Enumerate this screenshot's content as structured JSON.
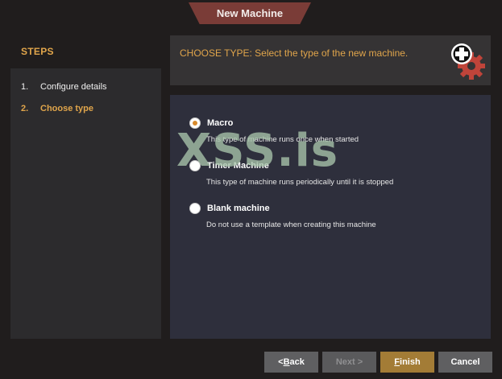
{
  "window": {
    "title": "New Machine"
  },
  "steps": {
    "header": "STEPS",
    "items": [
      {
        "num": "1.",
        "label": "Configure details",
        "active": false
      },
      {
        "num": "2.",
        "label": "Choose type",
        "active": true
      }
    ]
  },
  "banner": {
    "text": "CHOOSE TYPE: Select the type of the new machine.",
    "icon": "add-machine-gear-icon"
  },
  "options": [
    {
      "label": "Macro",
      "desc": "This type of machine runs once when started",
      "checked": true
    },
    {
      "label": "Timer Machine",
      "desc": "This type of machine runs periodically until it is stopped",
      "checked": false
    },
    {
      "label": "Blank machine",
      "desc": "Do not use a template when creating this machine",
      "checked": false
    }
  ],
  "watermark": "XSS.is",
  "buttons": {
    "back_prefix": "< ",
    "back_mnemonic": "B",
    "back_rest": "ack",
    "next": "Next >",
    "finish_mnemonic": "F",
    "finish_rest": "inish",
    "cancel": "Cancel"
  },
  "colors": {
    "accent": "#e0a54b",
    "title_tab": "#7a3c37",
    "finish": "#a37c36",
    "panel": "#2e2f3c"
  }
}
